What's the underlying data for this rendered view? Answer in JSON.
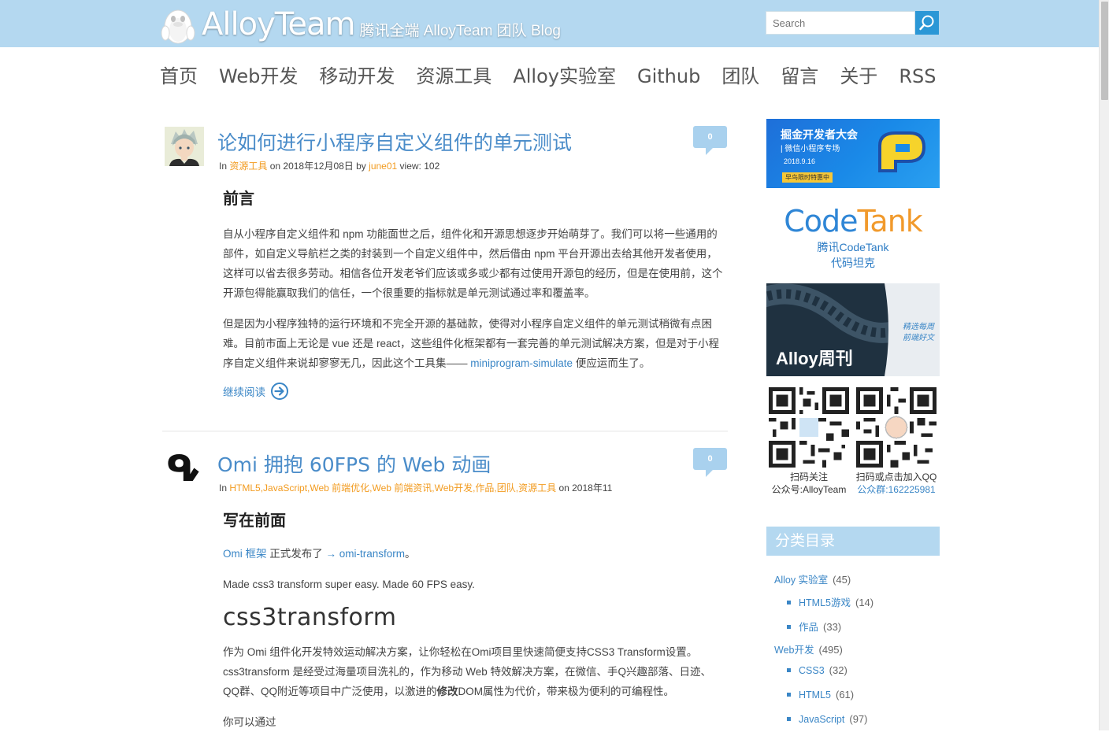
{
  "header": {
    "logo_text": "AlloyTeam",
    "tagline": "腾讯全端 AlloyTeam 团队 Blog",
    "search_placeholder": "Search"
  },
  "nav": [
    "首页",
    "Web开发",
    "移动开发",
    "资源工具",
    "Alloy实验室",
    "Github",
    "团队",
    "留言",
    "关于",
    "RSS"
  ],
  "posts": [
    {
      "title": "论如何进行小程序自定义组件的单元测试",
      "comments": "0",
      "meta_in": "In",
      "categories": "资源工具",
      "meta_on": "on 2018年12月08日 by",
      "author": "june01",
      "views": "view: 102",
      "heading": "前言",
      "para1": "自从小程序自定义组件和 npm 功能面世之后，组件化和开源思想逐步开始萌芽了。我们可以将一些通用的部件，如自定义导航栏之类的封装到一个自定义组件中，然后借由 npm 平台开源出去给其他开发者使用，这样可以省去很多劳动。相信各位开发老爷们应该或多或少都有过使用开源包的经历，但是在使用前，这个开源包得能赢取我们的信任，一个很重要的指标就是单元测试通过率和覆盖率。",
      "para2_a": "但是因为小程序独特的运行环境和不完全开源的基础款，使得对小程序自定义组件的单元测试稍微有点困难。目前市面上无论是 vue 还是 react，这些组件化框架都有一套完善的单元测试解决方案，但是对于小程序自定义组件来说却寥寥无几，因此这个工具集——",
      "para2_link": "miniprogram-simulate",
      "para2_b": "便应运而生了。",
      "read_more": "继续阅读"
    },
    {
      "title": "Omi 拥抱 60FPS 的 Web 动画",
      "comments": "0",
      "meta_in": "In",
      "categories": "HTML5,JavaScript,Web 前端优化,Web 前端资讯,Web开发,作品,团队,资源工具",
      "meta_on": "on 2018年11",
      "avatar_glyph": "ᕴ",
      "heading": "写在前面",
      "line1_link1": "Omi 框架",
      "line1_text": "正式发布了",
      "line1_link2": "→ omi-transform",
      "line1_end": "。",
      "line2": "Made css3 transform super easy. Made 60 FPS easy.",
      "big_word": "css3transform",
      "para3_a": "作为 Omi 组件化开发特效运动解决方案，让你轻松在Omi项目里快速简便支持CSS3 Transform设置。css3transform 是经受过海量项目洗礼的，作为移动 Web 特效解决方案，在微信、手Q兴趣部落、日迹、QQ群、QQ附近等项目中广泛使用，以激进的",
      "para3_bold": "修改",
      "para3_b": "DOM属性为代价，带来极为便利的可编程性。",
      "para4_cut": "你可以通过"
    }
  ],
  "sidebar": {
    "banner1": {
      "title": "掘金开发者大会",
      "subtitle": "| 微信小程序专场",
      "date": "2018.9.16",
      "badge": "早鸟限时特惠中"
    },
    "codetank": {
      "logo_code": "Code",
      "logo_tank": "Tank",
      "line1": "腾讯CodeTank",
      "line2": "代码坦克",
      "color_code": "#2f86d6",
      "color_tank": "#f19a2c"
    },
    "weekly": {
      "title": "Alloy周刊",
      "side1": "精选每周",
      "side2": "前端好文"
    },
    "qr1_line1": "扫码关注",
    "qr1_line2": "公众号:AlloyTeam",
    "qr2_line1": "扫码或点击加入QQ",
    "qr2_line2": "公众群:162225981",
    "categories_title": "分类目录",
    "categories": [
      {
        "name": "Alloy 实验室",
        "count": "(45)",
        "level": 0
      },
      {
        "name": "HTML5游戏",
        "count": "(14)",
        "level": 1
      },
      {
        "name": "作品",
        "count": "(33)",
        "level": 1
      },
      {
        "name": "Web开发",
        "count": "(495)",
        "level": 0
      },
      {
        "name": "CSS3",
        "count": "(32)",
        "level": 1
      },
      {
        "name": "HTML5",
        "count": "(61)",
        "level": 1
      },
      {
        "name": "JavaScript",
        "count": "(97)",
        "level": 1
      }
    ]
  },
  "colors": {
    "header_bg": "#b4d8f0",
    "link": "#3a86c6",
    "title": "#4a8cc9",
    "meta_link": "#f29b1f"
  }
}
